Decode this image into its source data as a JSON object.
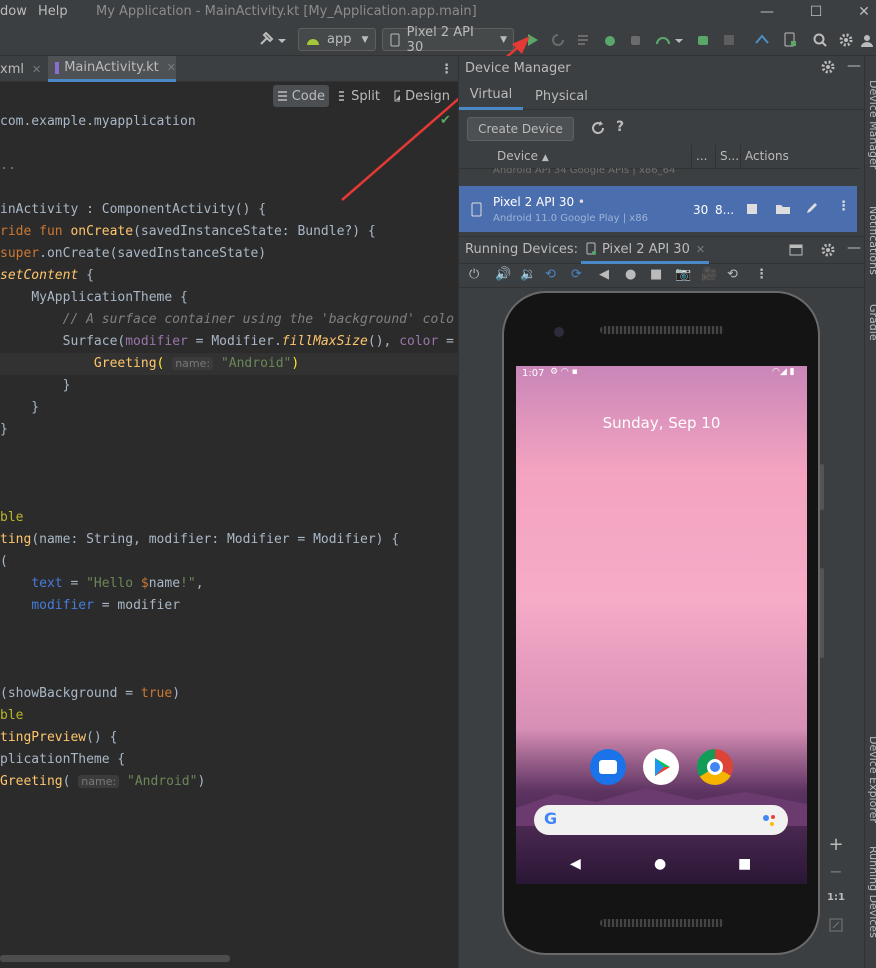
{
  "titlebar": {
    "menu_window": "dow",
    "menu_help": "Help",
    "title": "My Application - MainActivity.kt [My_Application.app.main]"
  },
  "toolbar": {
    "config": "app",
    "device": "Pixel 2 API 30"
  },
  "editor": {
    "tabs": [
      {
        "label": "xml"
      },
      {
        "label": "MainActivity.kt"
      }
    ],
    "modes": {
      "code": "Code",
      "split": "Split",
      "design": "Design"
    },
    "lines": [
      "com.example.myapplication",
      "",
      "..",
      "",
      "inActivity : ComponentActivity() {",
      "ride fun onCreate(savedInstanceState: Bundle?) {",
      "super.onCreate(savedInstanceState)",
      "setContent {",
      "    MyApplicationTheme {",
      "        // A surface container using the 'background' colo",
      "        Surface(modifier = Modifier.fillMaxSize(), color =",
      "            Greeting( name: \"Android\")",
      "        }",
      "    }",
      "}",
      "",
      "",
      "",
      "ble",
      "ting(name: String, modifier: Modifier = Modifier) {",
      "(",
      "    text = \"Hello $name!\",",
      "    modifier = modifier",
      "",
      "",
      "",
      "(showBackground = true)",
      "ble",
      "tingPreview() {",
      "plicationTheme {",
      "Greeting( name: \"Android\")"
    ],
    "hint_name": "name:"
  },
  "device_manager": {
    "title": "Device Manager",
    "tabs": {
      "virtual": "Virtual",
      "physical": "Physical"
    },
    "create_device": "Create Device",
    "columns": {
      "device": "Device",
      "s1": "...",
      "s2": "S...",
      "actions": "Actions"
    },
    "rows": [
      {
        "name": "Pixel 2 API 30",
        "sub": "Android 11.0 Google Play | x86",
        "api": "30",
        "size": "8..."
      }
    ],
    "partial_row_sub": "Android API 34 Google APIs | x86_64"
  },
  "running_devices": {
    "title": "Running Devices:",
    "tab": "Pixel 2 API 30"
  },
  "phone": {
    "time": "1:07",
    "date": "Sunday, Sep 10"
  },
  "zoom": {
    "plus": "+",
    "minus": "−",
    "ratio": "1:1"
  },
  "side": {
    "top": "Device Manager",
    "mid": "Notifications",
    "gradle": "Gradle",
    "explorer": "Device Explorer",
    "running": "Running Devices"
  },
  "colors": {
    "accent": "#4b6eaf",
    "run": "#59a869",
    "debug": "#6a8759"
  }
}
